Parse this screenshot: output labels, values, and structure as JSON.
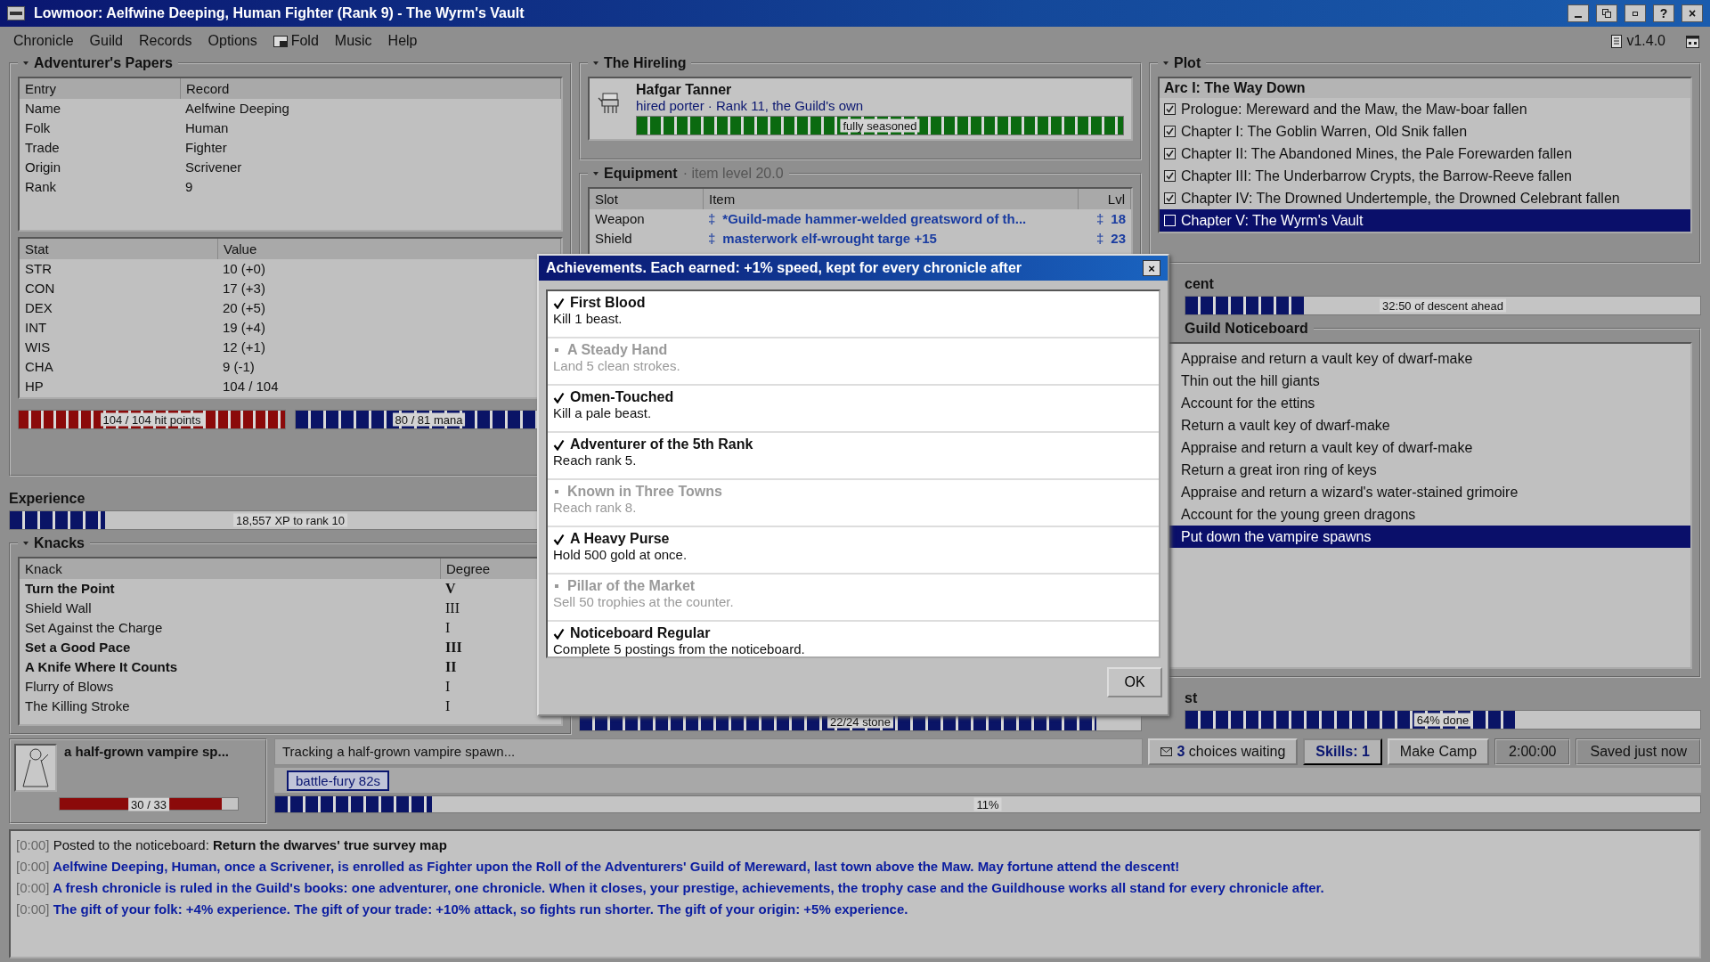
{
  "window": {
    "title": "Lowmoor: Aelfwine Deeping, Human Fighter (Rank 9) - The Wyrm's Vault",
    "controls": [
      {
        "kind": "minimize"
      },
      {
        "kind": "restore"
      },
      {
        "kind": "maximize"
      },
      {
        "kind": "text",
        "label": "?"
      },
      {
        "kind": "text",
        "label": "×"
      }
    ]
  },
  "menu": [
    {
      "label": "Chronicle",
      "kind": "plain"
    },
    {
      "label": "Guild",
      "kind": "plain"
    },
    {
      "label": "Records",
      "kind": "plain"
    },
    {
      "label": "Options",
      "kind": "plain"
    },
    {
      "label": "Fold",
      "kind": "icon"
    },
    {
      "label": "Music",
      "kind": "plain"
    },
    {
      "label": "Help",
      "kind": "plain"
    }
  ],
  "version": "v1.4.0",
  "papers": {
    "title": "Adventurer's Papers",
    "columns": [
      "Entry",
      "Record"
    ],
    "rows": [
      [
        "Name",
        "Aelfwine Deeping"
      ],
      [
        "Folk",
        "Human"
      ],
      [
        "Trade",
        "Fighter"
      ],
      [
        "Origin",
        "Scrivener"
      ],
      [
        "Rank",
        "9"
      ]
    ],
    "stat_columns": [
      "Stat",
      "Value"
    ],
    "stats": [
      [
        "STR",
        "10 (+0)"
      ],
      [
        "CON",
        "17 (+3)"
      ],
      [
        "DEX",
        "20 (+5)"
      ],
      [
        "INT",
        "19 (+4)"
      ],
      [
        "WIS",
        "12 (+1)"
      ],
      [
        "CHA",
        "9 (-1)"
      ],
      [
        "HP",
        "104 / 104"
      ]
    ],
    "hp": {
      "level": 1,
      "reading": "104 / 104 hit points"
    },
    "mana": {
      "level": 0.99,
      "reading": "80 / 81 mana"
    }
  },
  "experience": {
    "title": "Experience",
    "level": 0.17,
    "reading": "18,557 XP to rank 10"
  },
  "knacks": {
    "title": "Knacks",
    "columns": [
      "Knack",
      "Degree"
    ],
    "rows": [
      {
        "name": "Turn the Point",
        "degree": "V",
        "bold": true
      },
      {
        "name": "Shield Wall",
        "degree": "III",
        "bold": false
      },
      {
        "name": "Set Against the Charge",
        "degree": "I",
        "bold": false
      },
      {
        "name": "Set a Good Pace",
        "degree": "III",
        "bold": true
      },
      {
        "name": "A Knife Where It Counts",
        "degree": "II",
        "bold": true
      },
      {
        "name": "Flurry of Blows",
        "degree": "I",
        "bold": false
      },
      {
        "name": "The Killing Stroke",
        "degree": "I",
        "bold": false
      }
    ]
  },
  "hireling": {
    "title": "The Hireling",
    "name": "Hafgar Tanner",
    "role": "hired porter · Rank 11, the Guild's own",
    "level": 1,
    "reading": "fully seasoned"
  },
  "equipment": {
    "title": "Equipment",
    "note": "· item level 20.0",
    "columns": [
      "Slot",
      "Item",
      "Lvl"
    ],
    "rows": [
      {
        "slot": "Weapon",
        "mark": "‡",
        "item": "*Guild-made hammer-welded greatsword of th...",
        "lvl_mark": "‡",
        "lvl": "18"
      },
      {
        "slot": "Shield",
        "mark": "‡",
        "item": "masterwork elf-wrought targe +15",
        "lvl_mark": "‡",
        "lvl": "23"
      }
    ]
  },
  "load": {
    "level": 0.92,
    "reading": "22/24 stone"
  },
  "plot": {
    "title": "Plot",
    "arc": "Arc I: The Way Down",
    "chapters": [
      {
        "label": "Prologue: Mereward and the Maw, the Maw-boar fallen",
        "checked": true,
        "selected": false
      },
      {
        "label": "Chapter I: The Goblin Warren, Old Snik fallen",
        "checked": true,
        "selected": false
      },
      {
        "label": "Chapter II: The Abandoned Mines, the Pale Forewarden fallen",
        "checked": true,
        "selected": false
      },
      {
        "label": "Chapter III: The Underbarrow Crypts, the Barrow-Reeve fallen",
        "checked": true,
        "selected": false
      },
      {
        "label": "Chapter IV: The Drowned Undertemple, the Drowned Celebrant fallen",
        "checked": true,
        "selected": false
      },
      {
        "label": "Chapter V: The Wyrm's Vault",
        "checked": false,
        "selected": true
      }
    ]
  },
  "descent": {
    "title": "cent",
    "level": 0.23,
    "reading": "32:50 of descent ahead"
  },
  "noticeboard": {
    "title": "Guild Noticeboard",
    "items": [
      {
        "label": "Appraise and return a vault key of dwarf-make",
        "selected": false
      },
      {
        "label": "Thin out the hill giants",
        "selected": false
      },
      {
        "label": "Account for the ettins",
        "selected": false
      },
      {
        "label": "Return a vault key of dwarf-make",
        "selected": false
      },
      {
        "label": "Appraise and return a vault key of dwarf-make",
        "selected": false
      },
      {
        "label": "Return a great iron ring of keys",
        "selected": false
      },
      {
        "label": "Appraise and return a wizard's water-stained grimoire",
        "selected": false
      },
      {
        "label": "Account for the young green dragons",
        "selected": false
      },
      {
        "label": "Put down the vampire spawns",
        "selected": true
      }
    ]
  },
  "quest": {
    "title": "st",
    "level": 0.64,
    "reading": "64% done"
  },
  "foe": {
    "name": "a half-grown vampire sp...",
    "level": 0.91,
    "reading": "30 / 33"
  },
  "tracking": "Tracking a half-grown vampire spawn...",
  "buffs": [
    "battle-fury 82s"
  ],
  "progress": {
    "level": 0.11,
    "reading": "11%"
  },
  "status_buttons": [
    {
      "kind": "mail",
      "label": "**3** choices waiting"
    },
    {
      "kind": "skills",
      "label": "Skills: 1"
    },
    {
      "kind": "button",
      "label": "Make Camp"
    },
    {
      "kind": "readout",
      "label": "2:00:00"
    },
    {
      "kind": "readout",
      "label": "Saved just now"
    }
  ],
  "log": [
    {
      "time": "[0:00]",
      "kind": "plain",
      "text": "Posted to the noticeboard: **Return the dwarves' true survey map**"
    },
    {
      "time": "[0:00]",
      "kind": "story",
      "text": "Aelfwine Deeping, Human, once a Scrivener, is enrolled as Fighter upon the Roll of the Adventurers' Guild of Mereward, last town above the Maw. May fortune attend the descent!"
    },
    {
      "time": "[0:00]",
      "kind": "story",
      "text": "A fresh chronicle is ruled in the Guild's books: one adventurer, one chronicle. When it closes, your prestige, achievements, the trophy case and the Guildhouse works all stand for every chronicle after."
    },
    {
      "time": "[0:00]",
      "kind": "story",
      "text": "The gift of your folk: +4% experience. The gift of your trade: +10% attack, so fights run shorter. The gift of your origin: +5% experience."
    }
  ],
  "dialog": {
    "title": "Achievements. Each earned: +1% speed, kept for every chronicle after",
    "close": "×",
    "ok": "OK",
    "items": [
      {
        "name": "First Blood",
        "desc": "Kill 1 beast.",
        "earned": true
      },
      {
        "name": "A Steady Hand",
        "desc": "Land 5 clean strokes.",
        "earned": false
      },
      {
        "name": "Omen-Touched",
        "desc": "Kill a pale beast.",
        "earned": true
      },
      {
        "name": "Adventurer of the 5th Rank",
        "desc": "Reach rank 5.",
        "earned": true
      },
      {
        "name": "Known in Three Towns",
        "desc": "Reach rank 8.",
        "earned": false
      },
      {
        "name": "A Heavy Purse",
        "desc": "Hold 500 gold at once.",
        "earned": true
      },
      {
        "name": "Pillar of the Market",
        "desc": "Sell 50 trophies at the counter.",
        "earned": false
      },
      {
        "name": "Noticeboard Regular",
        "desc": "Complete 5 postings from the noticeboard.",
        "earned": true
      }
    ]
  }
}
